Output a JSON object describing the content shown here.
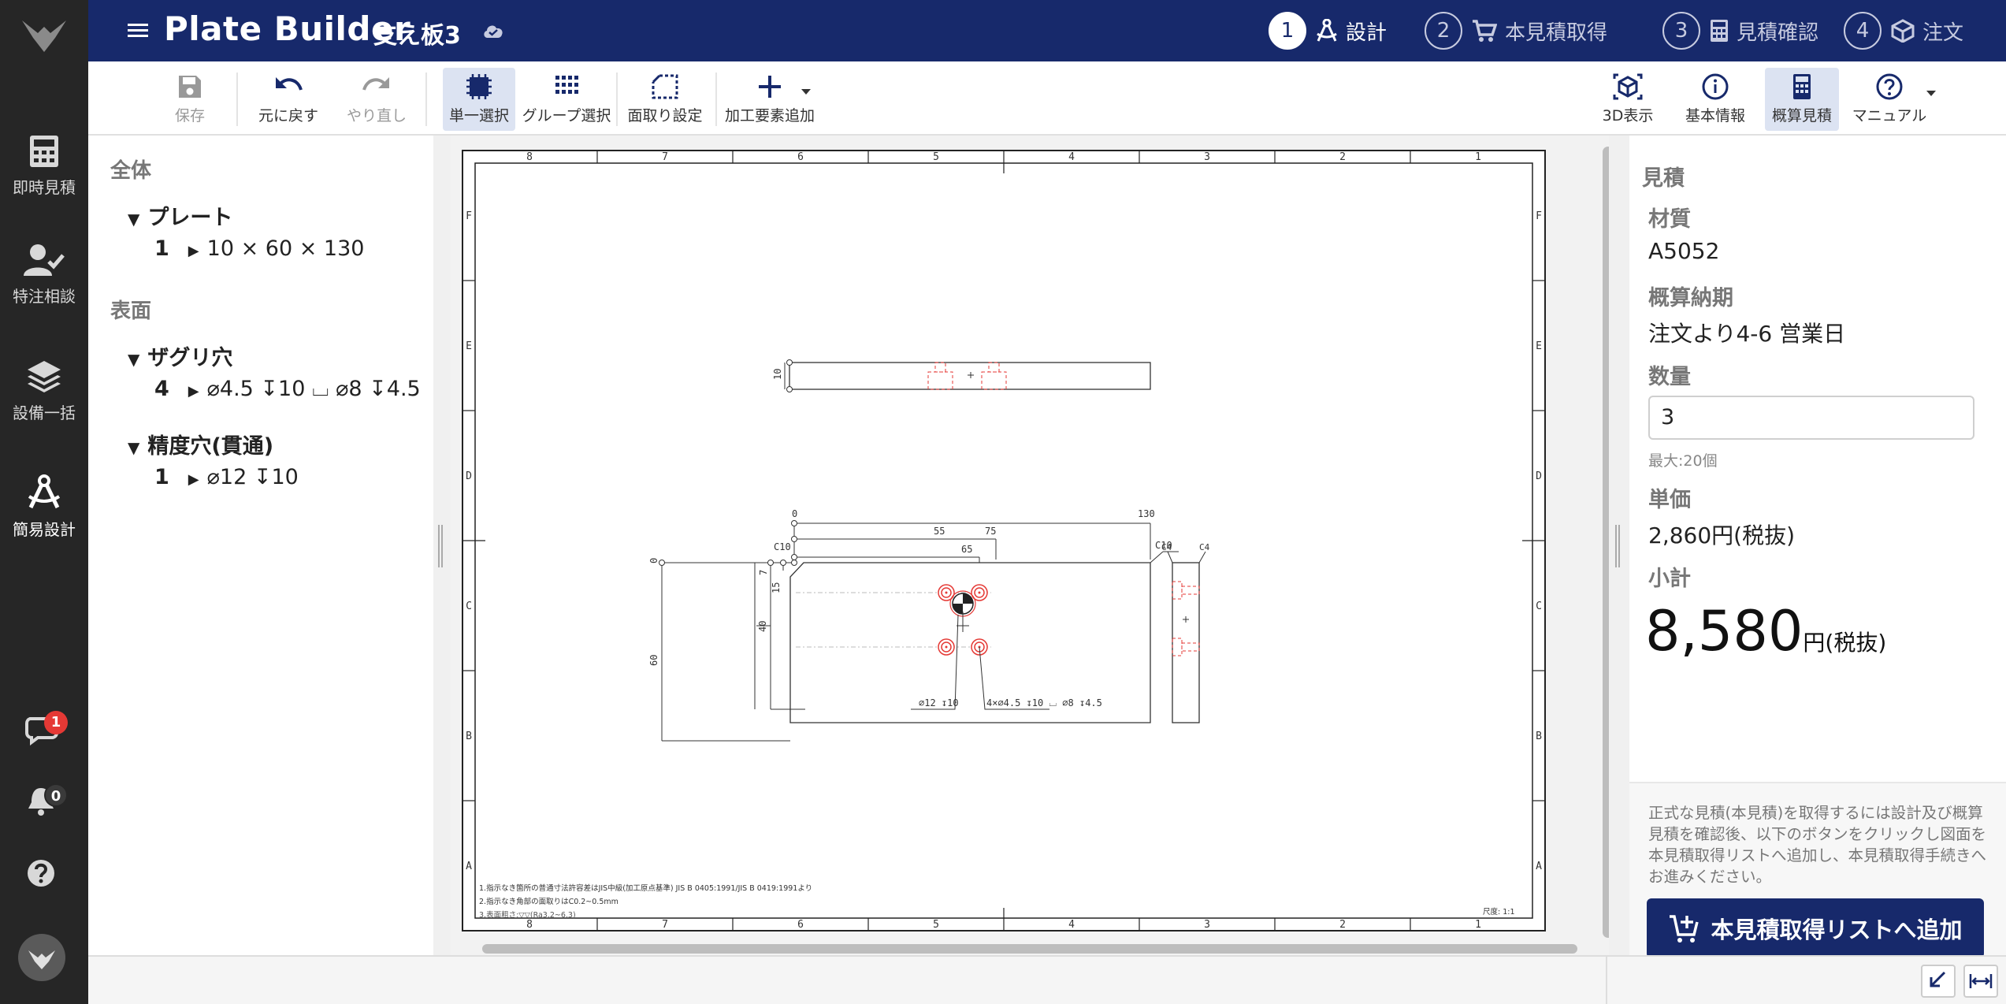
{
  "app": {
    "title": "Plate Builder",
    "document_name": "支え板3"
  },
  "rail": {
    "items": [
      {
        "label": "即時見積",
        "icon": "calculator-icon"
      },
      {
        "label": "特注相談",
        "icon": "person-check-icon"
      },
      {
        "label": "設備一括",
        "icon": "layers-icon"
      },
      {
        "label": "簡易設計",
        "icon": "compass-icon",
        "active": true
      }
    ],
    "chat_badge": "1",
    "notification_badge": "0"
  },
  "steps": [
    {
      "num": "1",
      "label": "設計",
      "active": true
    },
    {
      "num": "2",
      "label": "本見積取得"
    },
    {
      "num": "3",
      "label": "見積確認"
    },
    {
      "num": "4",
      "label": "注文"
    }
  ],
  "toolbar": {
    "save": "保存",
    "undo": "元に戻す",
    "redo": "やり直し",
    "single_select": "単一選択",
    "group_select": "グループ選択",
    "chamfer": "面取り設定",
    "add_feature": "加工要素追加",
    "view3d": "3D表示",
    "basic_info": "基本情報",
    "rough_estimate": "概算見積",
    "manual": "マニュアル"
  },
  "tree": {
    "section_whole": "全体",
    "plate_group": "プレート",
    "plate_row": {
      "qty": "1",
      "text": "10 × 60 × 130"
    },
    "section_surface": "表面",
    "counterbore_group": "ザグリ穴",
    "counterbore_row": {
      "qty": "4",
      "text": "⌀4.5 ↧10 ⌴ ⌀8 ↧4.5"
    },
    "precision_group": "精度穴(貫通)",
    "precision_row": {
      "qty": "1",
      "text": "⌀12 ↧10"
    }
  },
  "drawing": {
    "col_labels": [
      "8",
      "7",
      "6",
      "5",
      "4",
      "3",
      "2",
      "1"
    ],
    "row_labels": [
      "F",
      "E",
      "D",
      "C",
      "B",
      "A"
    ],
    "dims": {
      "thickness": "10",
      "x0": "0",
      "x55": "55",
      "x65": "65",
      "x75": "75",
      "x130": "130",
      "y0": "0",
      "y7": "7",
      "y15": "15",
      "y40": "40",
      "y60": "60",
      "c10_left": "C10",
      "c10_right": "C10",
      "c4_a": "C4",
      "c4_b": "C4"
    },
    "callout_hole": "⌀12 ↧10",
    "callout_cbore": "4×⌀4.5 ↧10 ⌴ ⌀8 ↧4.5",
    "notes": [
      "1.指示なき箇所の普通寸法許容差はJIS中級(加工原点基準) JIS B 0405:1991/JIS B 0419:1991より",
      "2.指示なき角部の面取りはC0.2~0.5mm",
      "3.表面粗さ:▽▽(Ra3.2~6.3)"
    ],
    "scale": "尺度: 1:1"
  },
  "estimate": {
    "title": "見積",
    "material_label": "材質",
    "material": "A5052",
    "lead_label": "概算納期",
    "lead": "注文より4-6 営業日",
    "qty_label": "数量",
    "qty": "3",
    "qty_hint": "最大:20個",
    "unit_label": "単価",
    "unit_price": "2,860円(税抜)",
    "subtotal_label": "小計",
    "subtotal": "8,580",
    "subtotal_unit": "円",
    "subtotal_tax": "(税抜)",
    "note": "正式な見積(本見積)を取得するには設計及び概算見積を確認後、以下のボタンをクリックし図面を本見積取得リストへ追加し、本見積取得手続きへお進みください。",
    "cta": "本見積取得リストへ追加"
  }
}
